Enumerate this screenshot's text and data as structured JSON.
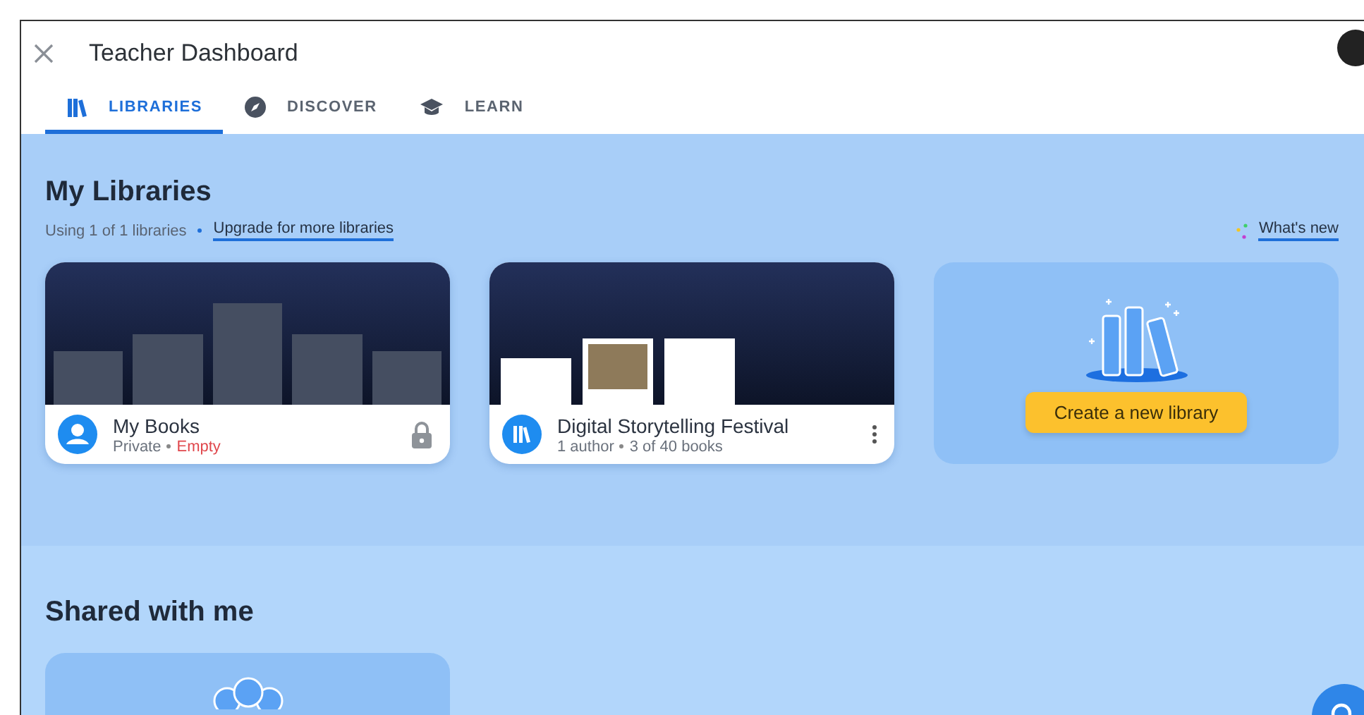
{
  "window": {
    "title": "Teacher Dashboard"
  },
  "tabs": [
    {
      "kind": "libraries",
      "label": "LIBRARIES",
      "selected": true
    },
    {
      "kind": "discover",
      "label": "DISCOVER",
      "selected": false
    },
    {
      "kind": "learn",
      "label": "LEARN",
      "selected": false
    }
  ],
  "my_libraries": {
    "heading": "My Libraries",
    "usage": "Using 1 of 1 libraries",
    "upgrade_link": "Upgrade for more libraries",
    "whats_new": "What's new",
    "libraries": [
      {
        "kind": "private",
        "name": "My Books",
        "meta": "Private",
        "status": "Empty"
      },
      {
        "kind": "shared",
        "name": "Digital Storytelling Festival",
        "meta": "1 author",
        "status": "3 of 40 books"
      }
    ],
    "create_button": "Create a new library"
  },
  "shared_with_me": {
    "heading": "Shared with me"
  }
}
